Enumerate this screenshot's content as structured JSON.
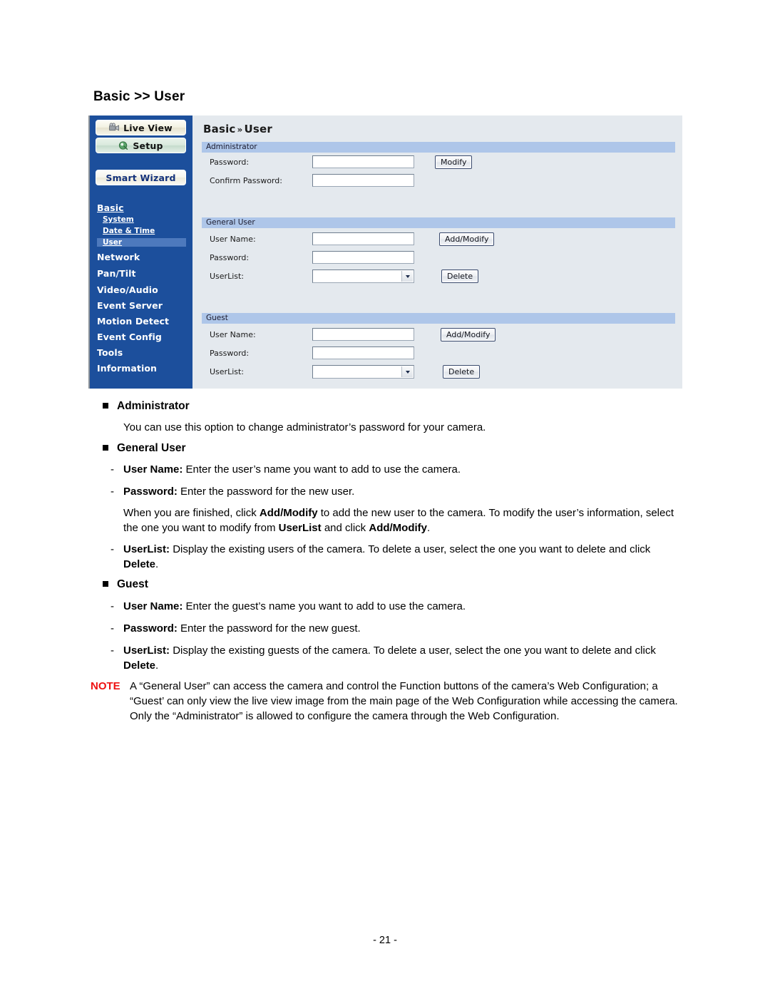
{
  "page": {
    "heading": "Basic >> User",
    "number": "- 21 -"
  },
  "camera_ui": {
    "title_primary": "Basic",
    "title_chevron": "»",
    "title_secondary": "User",
    "sidebar": {
      "buttons": [
        {
          "label": "Live View",
          "icon": "camcorder-icon"
        },
        {
          "label": "Setup",
          "icon": "setup-gear-icon"
        },
        {
          "label": "Smart Wizard",
          "icon": "none"
        }
      ],
      "nav": [
        {
          "label": "Basic",
          "type": "section",
          "selected": false
        },
        {
          "label": "System",
          "type": "sub",
          "selected": false
        },
        {
          "label": "Date & Time",
          "type": "sub",
          "selected": false
        },
        {
          "label": "User",
          "type": "sub",
          "selected": true
        },
        {
          "label": "Network",
          "type": "top",
          "selected": false
        },
        {
          "label": "Pan/Tilt",
          "type": "top",
          "selected": false
        },
        {
          "label": "Video/Audio",
          "type": "top",
          "selected": false
        },
        {
          "label": "Event Server",
          "type": "top",
          "selected": false
        },
        {
          "label": "Motion Detect",
          "type": "top",
          "selected": false
        },
        {
          "label": "Event Config",
          "type": "top",
          "selected": false
        },
        {
          "label": "Tools",
          "type": "top",
          "selected": false
        },
        {
          "label": "Information",
          "type": "top",
          "selected": false
        }
      ]
    },
    "sections": {
      "administrator": {
        "header": "Administrator",
        "password_label": "Password:",
        "password_value": "",
        "confirm_label": "Confirm Password:",
        "confirm_value": "",
        "button": "Modify"
      },
      "general_user": {
        "header": "General User",
        "username_label": "User Name:",
        "username_value": "",
        "password_label": "Password:",
        "password_value": "",
        "userlist_label": "UserList:",
        "userlist_value": "",
        "add_button": "Add/Modify",
        "delete_button": "Delete"
      },
      "guest": {
        "header": "Guest",
        "username_label": "User Name:",
        "username_value": "",
        "password_label": "Password:",
        "password_value": "",
        "userlist_label": "UserList:",
        "userlist_value": "",
        "add_button": "Add/Modify",
        "delete_button": "Delete"
      }
    },
    "colors": {
      "sidebar_blue": "#1c4f9c",
      "section_header_blue": "#aec6e9",
      "content_bg": "#e4e9ee",
      "selected_nav_blue": "#4d79bd"
    }
  },
  "doc": {
    "administrator": {
      "heading": "Administrator",
      "paragraph": "You can use this option to change administrator’s password for your camera."
    },
    "general_user": {
      "heading": "General User",
      "items": [
        {
          "term": "User Name:",
          "text": " Enter the user’s name you want to add to use the camera."
        },
        {
          "term": "Password:",
          "text": " Enter the password for the new user."
        }
      ],
      "paragraph_parts": [
        {
          "t": "When you are finished, click ",
          "b": false
        },
        {
          "t": "Add/Modify",
          "b": true
        },
        {
          "t": " to add the new user to the camera. To modify the user’s information, select the one you want to modify from ",
          "b": false
        },
        {
          "t": "UserList",
          "b": true
        },
        {
          "t": " and click ",
          "b": false
        },
        {
          "t": "Add/Modify",
          "b": true
        },
        {
          "t": ".",
          "b": false
        }
      ],
      "userlist_parts": [
        {
          "t": "UserList:",
          "b": true
        },
        {
          "t": " Display the existing users of the camera. To delete a user, select the one you want to delete and click ",
          "b": false
        },
        {
          "t": "Delete",
          "b": true
        },
        {
          "t": ".",
          "b": false
        }
      ]
    },
    "guest": {
      "heading": "Guest",
      "items": [
        {
          "term": "User Name:",
          "text": " Enter the guest’s name you want to add to use the camera."
        },
        {
          "term": "Password:",
          "text": " Enter the password for the new guest."
        }
      ],
      "userlist_parts": [
        {
          "t": "UserList:",
          "b": true
        },
        {
          "t": " Display the existing guests of the camera. To delete a user, select the one you want to delete and click ",
          "b": false
        },
        {
          "t": "Delete",
          "b": true
        },
        {
          "t": ".",
          "b": false
        }
      ]
    },
    "note": {
      "tag": "NOTE",
      "body": "A “General User” can access the camera and control the Function buttons of the camera’s Web Configuration; a “Guest’ can only view the live view image from the main page of the Web Configuration while accessing the camera. Only the “Administrator” is allowed to configure the camera through the Web Configuration."
    }
  }
}
